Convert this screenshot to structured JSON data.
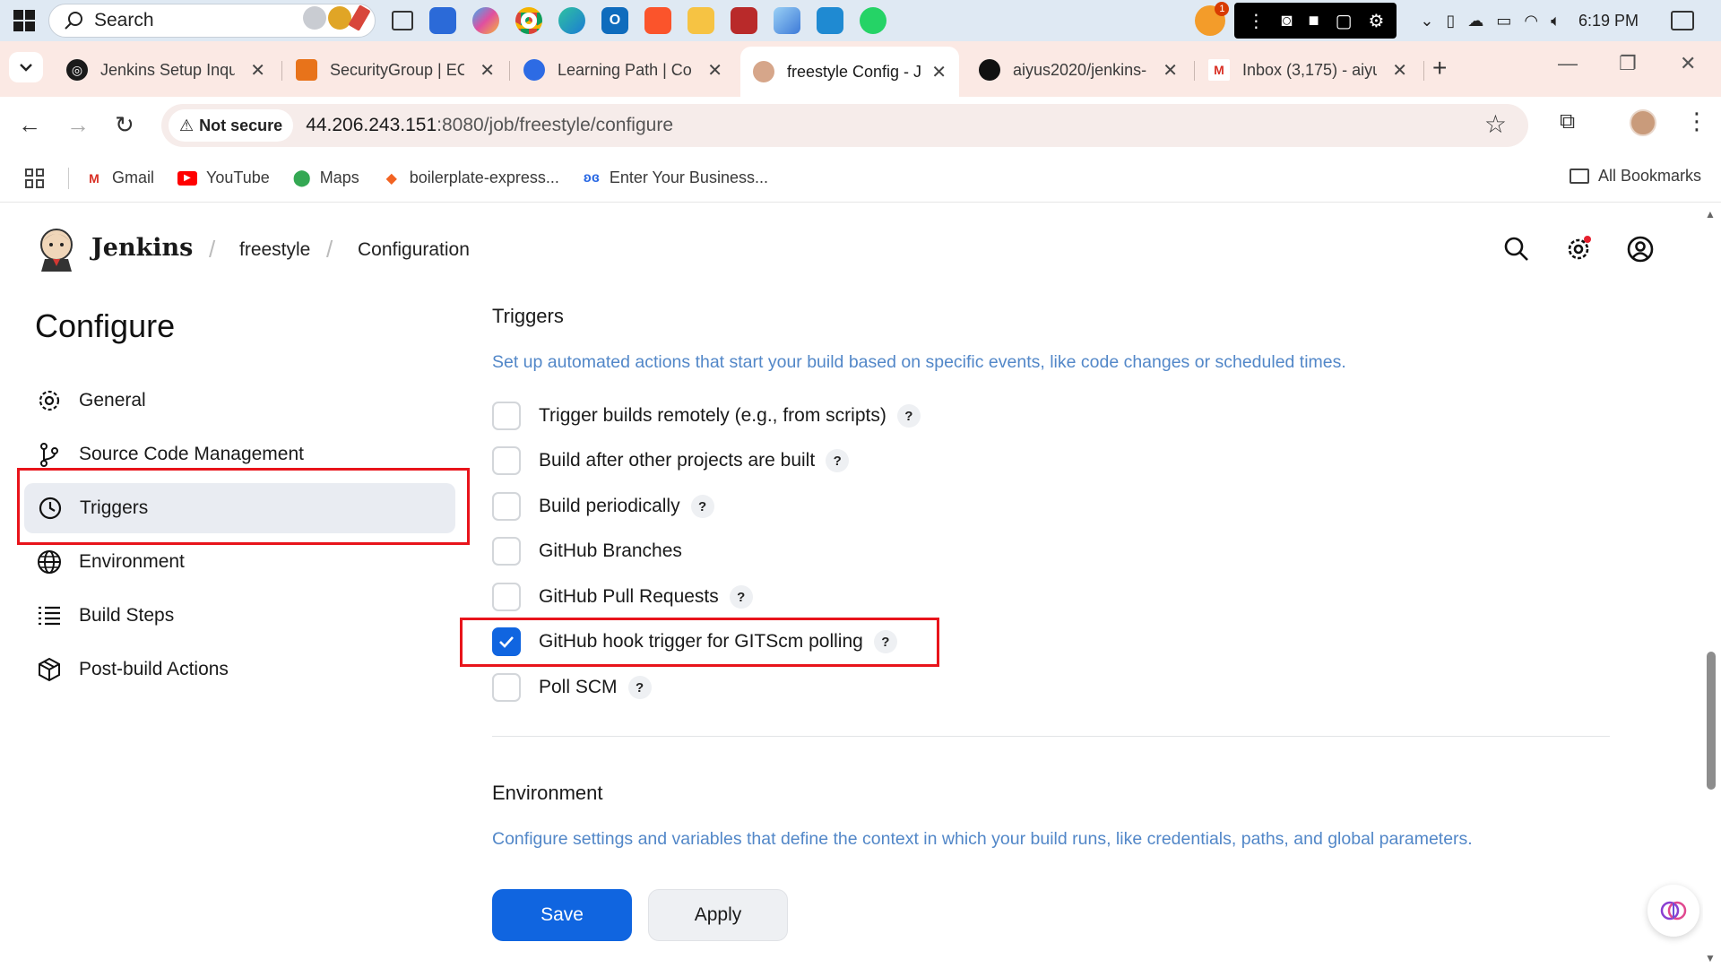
{
  "taskbar": {
    "search_label": "Search",
    "notification_count": "1",
    "clock": "6:19 PM"
  },
  "tabs": [
    {
      "title": "Jenkins Setup Inqu",
      "icon": "chatgpt-icon"
    },
    {
      "title": "SecurityGroup | EC",
      "icon": "aws-icon"
    },
    {
      "title": "Learning Path | Col",
      "icon": "learning-icon"
    },
    {
      "title": "freestyle Config - J",
      "icon": "jenkins-icon",
      "active": true
    },
    {
      "title": "aiyus2020/jenkins-",
      "icon": "github-icon"
    },
    {
      "title": "Inbox (3,175) - aiyu",
      "icon": "gmail-icon"
    }
  ],
  "address_bar": {
    "security_label": "Not secure",
    "url_host": "44.206.243.151",
    "url_rest": ":8080/job/freestyle/configure"
  },
  "bookmarks": {
    "items": [
      "Gmail",
      "YouTube",
      "Maps",
      "boilerplate-express...",
      "Enter Your Business..."
    ],
    "all_label": "All Bookmarks"
  },
  "jenkins": {
    "brand": "Jenkins",
    "breadcrumb": [
      "freestyle",
      "Configuration"
    ]
  },
  "sidebar": {
    "title": "Configure",
    "items": [
      {
        "label": "General",
        "icon": "gear-icon"
      },
      {
        "label": "Source Code Management",
        "icon": "branch-icon"
      },
      {
        "label": "Triggers",
        "icon": "clock-icon",
        "active": true
      },
      {
        "label": "Environment",
        "icon": "globe-icon"
      },
      {
        "label": "Build Steps",
        "icon": "list-icon"
      },
      {
        "label": "Post-build Actions",
        "icon": "package-icon"
      }
    ]
  },
  "triggers": {
    "title": "Triggers",
    "description": "Set up automated actions that start your build based on specific events, like code changes or scheduled times.",
    "options": [
      {
        "label": "Trigger builds remotely (e.g., from scripts)",
        "checked": false,
        "help": true
      },
      {
        "label": "Build after other projects are built",
        "checked": false,
        "help": true
      },
      {
        "label": "Build periodically",
        "checked": false,
        "help": true
      },
      {
        "label": "GitHub Branches",
        "checked": false,
        "help": false
      },
      {
        "label": "GitHub Pull Requests",
        "checked": false,
        "help": true
      },
      {
        "label": "GitHub hook trigger for GITScm polling",
        "checked": true,
        "help": true
      },
      {
        "label": "Poll SCM",
        "checked": false,
        "help": true
      }
    ],
    "help_glyph": "?"
  },
  "environment": {
    "title": "Environment",
    "description": "Configure settings and variables that define the context in which your build runs, like credentials, paths, and global parameters."
  },
  "actions": {
    "save_label": "Save",
    "apply_label": "Apply"
  },
  "colors": {
    "accent": "#1065e0",
    "highlight_box": "#e8141b",
    "description_text": "#5287c8"
  }
}
